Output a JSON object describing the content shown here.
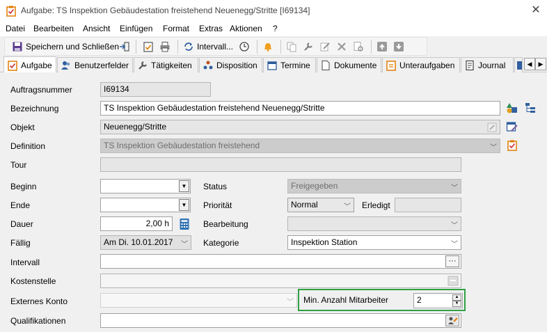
{
  "window": {
    "title": "Aufgabe: TS Inspektion Gebäudestation freistehend Neuenegg/Stritte [I69134]",
    "close_glyph": "✕"
  },
  "menu": [
    "Datei",
    "Bearbeiten",
    "Ansicht",
    "Einfügen",
    "Format",
    "Extras",
    "Aktionen",
    "?"
  ],
  "toolbar": {
    "save_close": "Speichern und Schließen",
    "intervall": "Intervall..."
  },
  "tabs": [
    {
      "label": "Aufgabe",
      "icon": "task-check-icon",
      "color": "#e07a00"
    },
    {
      "label": "Benutzerfelder",
      "icon": "users-icon",
      "color": "#3060a0"
    },
    {
      "label": "Tätigkeiten",
      "icon": "wrench-icon",
      "color": "#555555"
    },
    {
      "label": "Disposition",
      "icon": "disposition-icon",
      "color": "#3060a0"
    },
    {
      "label": "Termine",
      "icon": "calendar-icon",
      "color": "#2a5a9a"
    },
    {
      "label": "Dokumente",
      "icon": "document-icon",
      "color": "#666666"
    },
    {
      "label": "Unteraufgaben",
      "icon": "subtask-icon",
      "color": "#e07a00"
    },
    {
      "label": "Journal",
      "icon": "journal-icon",
      "color": "#444444"
    }
  ],
  "form": {
    "auftragsnummer_label": "Auftragsnummer",
    "auftragsnummer": "I69134",
    "bezeichnung_label": "Bezeichnung",
    "bezeichnung": "TS Inspektion Gebäudestation freistehend Neuenegg/Stritte",
    "objekt_label": "Objekt",
    "objekt": "Neuenegg/Stritte",
    "definition_label": "Definition",
    "definition": "TS Inspektion Gebäudestation freistehend",
    "tour_label": "Tour",
    "tour": "",
    "beginn_label": "Beginn",
    "beginn": "",
    "ende_label": "Ende",
    "ende": "",
    "dauer_label": "Dauer",
    "dauer": "2,00 h",
    "faellig_label": "Fällig",
    "faellig": "Am Di. 10.01.2017",
    "intervall_label": "Intervall",
    "intervall": "",
    "kostenstelle_label": "Kostenstelle",
    "kostenstelle": "",
    "externes_konto_label": "Externes Konto",
    "externes_konto": "",
    "qualifikationen_label": "Qualifikationen",
    "qualifikationen": "",
    "status_label": "Status",
    "status": "Freigegeben",
    "prioritaet_label": "Priorität",
    "prioritaet": "Normal",
    "erledigt_label": "Erledigt",
    "erledigt": "",
    "bearbeitung_label": "Bearbeitung",
    "bearbeitung": "",
    "kategorie_label": "Kategorie",
    "kategorie": "Inspektion Station",
    "min_mitarbeiter_label": "Min.  Anzahl Mitarbeiter",
    "min_mitarbeiter": "2",
    "ellipsis": "···"
  },
  "colors": {
    "highlight_border": "#2ea043",
    "accent_orange": "#e07a00",
    "accent_blue": "#3060a0"
  }
}
